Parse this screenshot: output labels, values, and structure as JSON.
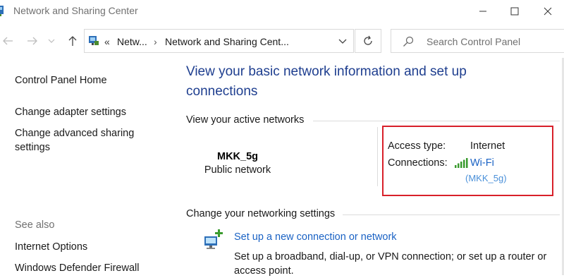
{
  "window": {
    "title": "Network and Sharing Center"
  },
  "nav": {
    "breadcrumb_sep": "«",
    "breadcrumb": [
      "Netw...",
      "Network and Sharing Cent..."
    ]
  },
  "search": {
    "placeholder": "Search Control Panel"
  },
  "sidebar": {
    "links": [
      "Control Panel Home",
      "Change adapter settings",
      "Change advanced sharing\nsettings"
    ],
    "see_also_label": "See also",
    "see_also": [
      "Internet Options",
      "Windows Defender Firewall"
    ]
  },
  "main": {
    "heading": "View your basic network information and set up connections",
    "active_networks_label": "View your active networks",
    "network": {
      "name": "MKK_5g",
      "category": "Public network",
      "access_type_label": "Access type:",
      "access_type_value": "Internet",
      "connections_label": "Connections:",
      "connection_name": "Wi-Fi",
      "connection_ssid": "(MKK_5g)"
    },
    "change_settings_label": "Change your networking settings",
    "setup": {
      "link": "Set up a new connection or network",
      "description": "Set up a broadband, dial-up, or VPN connection; or set up a router or access point."
    }
  },
  "colors": {
    "heading": "#1e3e8f",
    "link": "#1a62c4",
    "highlight": "#d8202a",
    "signal": "#3a9b2e"
  }
}
